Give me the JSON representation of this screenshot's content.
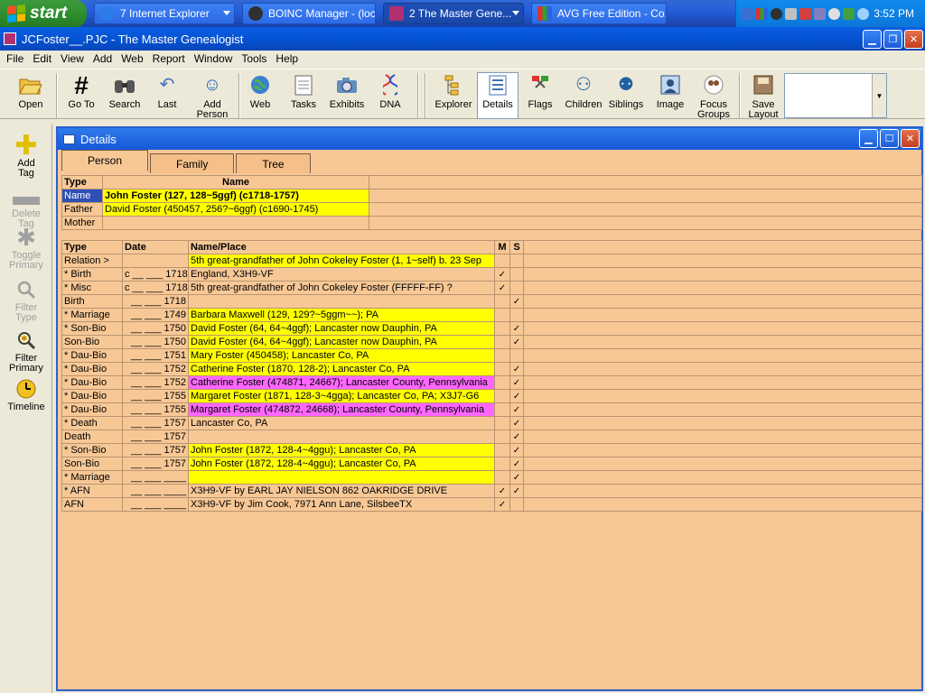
{
  "taskbar": {
    "start_label": "start",
    "tasks": [
      {
        "label": "7 Internet Explorer",
        "color": "#2b7de9"
      },
      {
        "label": "BOINC Manager - (loc...",
        "color": "#303030"
      },
      {
        "label": "2 The Master Gene...",
        "color": "#b03070"
      },
      {
        "label": "AVG Free Edition - Co...",
        "color": "#e0a020"
      }
    ],
    "clock": "3:52 PM"
  },
  "window": {
    "title": "JCFoster__.PJC - The Master Genealogist"
  },
  "menu": [
    "File",
    "Edit",
    "View",
    "Add",
    "Web",
    "Report",
    "Window",
    "Tools",
    "Help"
  ],
  "toolbar": {
    "open": "Open",
    "goto": "Go To",
    "search": "Search",
    "last": "Last",
    "add_person_1": "Add",
    "add_person_2": "Person",
    "web": "Web",
    "tasks": "Tasks",
    "exhibits": "Exhibits",
    "dna": "DNA",
    "explorer": "Explorer",
    "details": "Details",
    "flags": "Flags",
    "children": "Children",
    "siblings": "Siblings",
    "image": "Image",
    "focus_1": "Focus",
    "focus_2": "Groups",
    "save_1": "Save",
    "save_2": "Layout"
  },
  "sidebar": {
    "add_tag_1": "Add",
    "add_tag_2": "Tag",
    "delete_tag_1": "Delete",
    "delete_tag_2": "Tag",
    "toggle_1": "Toggle",
    "toggle_2": "Primary",
    "filter_type_1": "Filter",
    "filter_type_2": "Type",
    "filter_primary_1": "Filter",
    "filter_primary_2": "Primary",
    "timeline": "Timeline"
  },
  "details": {
    "title": "Details",
    "tabs": [
      "Person",
      "Family",
      "Tree"
    ],
    "names_headers": {
      "type": "Type",
      "name": "Name"
    },
    "names": [
      {
        "type": "Name",
        "value": "John Foster (127, 128~5ggf)  (c1718-1757)"
      },
      {
        "type": "Father",
        "value": "David Foster (450457, 256?~6ggf)  (c1690-1745)"
      },
      {
        "type": "Mother",
        "value": ""
      }
    ],
    "events_headers": {
      "type": "Type",
      "date": "Date",
      "place": "Name/Place",
      "m": "M",
      "s": "S"
    },
    "events": [
      {
        "type": "Relation >",
        "date": "",
        "place": "5th great-grandfather of John Cokeley Foster (1, 1~self) b. 23 Sep",
        "m": "",
        "s": "",
        "hl": "y"
      },
      {
        "type": "* Birth",
        "date": "c __ ___ 1718",
        "place": "England, X3H9-VF",
        "m": "✓",
        "s": "",
        "hl": ""
      },
      {
        "type": "* Misc",
        "date": "c __ ___ 1718",
        "place": "5th great-grandfather of John Cokeley Foster (FFFFF-FF) ?",
        "m": "✓",
        "s": "",
        "hl": ""
      },
      {
        "type": "Birth",
        "date": "__ ___ 1718",
        "place": "",
        "m": "",
        "s": "✓",
        "hl": ""
      },
      {
        "type": "* Marriage",
        "date": "__ ___ 1749",
        "place": "Barbara Maxwell (129, 129?~5ggm~~); PA",
        "m": "",
        "s": "",
        "hl": "y"
      },
      {
        "type": "* Son-Bio",
        "date": "__ ___ 1750",
        "place": "David Foster (64, 64~4ggf); Lancaster now Dauphin, PA",
        "m": "",
        "s": "✓",
        "hl": "y"
      },
      {
        "type": "Son-Bio",
        "date": "__ ___ 1750",
        "place": "David Foster (64, 64~4ggf); Lancaster now Dauphin, PA",
        "m": "",
        "s": "✓",
        "hl": "y"
      },
      {
        "type": "* Dau-Bio",
        "date": "__ ___ 1751",
        "place": "Mary Foster (450458); Lancaster Co, PA",
        "m": "",
        "s": "",
        "hl": "y"
      },
      {
        "type": "* Dau-Bio",
        "date": "__ ___ 1752",
        "place": "Catherine Foster (1870, 128-2); Lancaster Co, PA",
        "m": "",
        "s": "✓",
        "hl": "y"
      },
      {
        "type": "* Dau-Bio",
        "date": "__ ___ 1752",
        "place": "Catherine Foster (474871, 24667); Lancaster County, Pennsylvania",
        "m": "",
        "s": "✓",
        "hl": "pk"
      },
      {
        "type": "* Dau-Bio",
        "date": "__ ___ 1755",
        "place": "Margaret Foster (1871, 128-3~4gga); Lancaster Co, PA; X3J7-G6",
        "m": "",
        "s": "✓",
        "hl": "y"
      },
      {
        "type": "* Dau-Bio",
        "date": "__ ___ 1755",
        "place": "Margaret Foster (474872, 24668); Lancaster County, Pennsylvania",
        "m": "",
        "s": "✓",
        "hl": "pk"
      },
      {
        "type": "* Death",
        "date": "__ ___ 1757",
        "place": "Lancaster Co, PA",
        "m": "",
        "s": "✓",
        "hl": ""
      },
      {
        "type": "Death",
        "date": "__ ___ 1757",
        "place": "",
        "m": "",
        "s": "✓",
        "hl": ""
      },
      {
        "type": "* Son-Bio",
        "date": "__ ___ 1757",
        "place": "John Foster (1872, 128-4~4ggu); Lancaster Co, PA",
        "m": "",
        "s": "✓",
        "hl": "y"
      },
      {
        "type": "Son-Bio",
        "date": "__ ___ 1757",
        "place": "John Foster (1872, 128-4~4ggu); Lancaster Co, PA",
        "m": "",
        "s": "✓",
        "hl": "y"
      },
      {
        "type": "* Marriage",
        "date": "__ ___ ____",
        "place": "",
        "m": "",
        "s": "✓",
        "hl": "y"
      },
      {
        "type": "* AFN",
        "date": "__ ___ ____",
        "place": "X3H9-VF by EARL JAY NIELSON  862 OAKRIDGE DRIVE",
        "m": "✓",
        "s": "✓",
        "hl": ""
      },
      {
        "type": "AFN",
        "date": "__ ___ ____",
        "place": "X3H9-VF by Jim Cook, 7971 Ann Lane, SilsbeeTX",
        "m": "✓",
        "s": "",
        "hl": ""
      }
    ]
  }
}
